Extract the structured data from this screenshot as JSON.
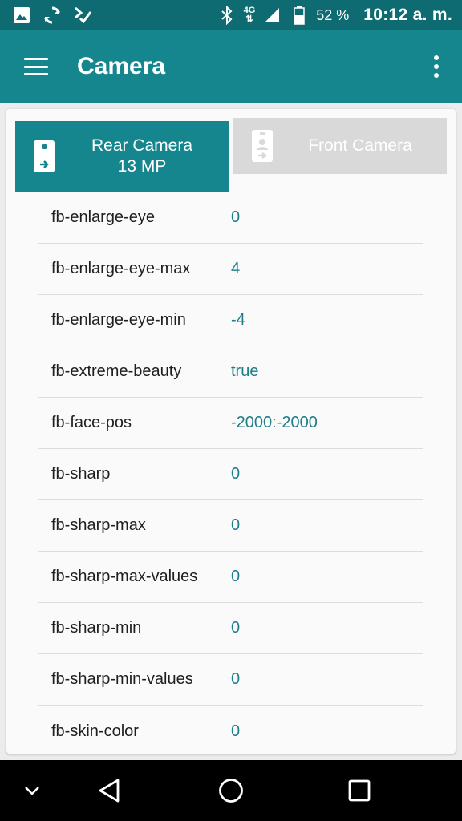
{
  "status_bar": {
    "icons_left": [
      "image-icon",
      "sync-icon",
      "checklist-icon"
    ],
    "icons_right": [
      "bluetooth-icon",
      "network-4g-icon",
      "signal-icon",
      "battery-icon"
    ],
    "network_label": "4G",
    "battery_percent": "52 %",
    "time": "10:12 a. m."
  },
  "app_bar": {
    "title": "Camera"
  },
  "tabs": {
    "rear": {
      "line1": "Rear Camera",
      "line2": "13 MP",
      "selected": true
    },
    "front": {
      "label": "Front Camera",
      "selected": false
    }
  },
  "parameters": [
    {
      "key": "fb-enlarge-eye",
      "value": "0"
    },
    {
      "key": "fb-enlarge-eye-max",
      "value": "4"
    },
    {
      "key": "fb-enlarge-eye-min",
      "value": "-4"
    },
    {
      "key": "fb-extreme-beauty",
      "value": "true"
    },
    {
      "key": "fb-face-pos",
      "value": "-2000:-2000"
    },
    {
      "key": "fb-sharp",
      "value": "0"
    },
    {
      "key": "fb-sharp-max",
      "value": "0"
    },
    {
      "key": "fb-sharp-max-values",
      "value": "0"
    },
    {
      "key": "fb-sharp-min",
      "value": "0"
    },
    {
      "key": "fb-sharp-min-values",
      "value": "0"
    },
    {
      "key": "fb-skin-color",
      "value": "0"
    }
  ],
  "colors": {
    "primary": "#15858e",
    "primary_dark": "#0f6b72",
    "value_text": "#1e7d8a",
    "tab_inactive": "#d9d9d9"
  }
}
